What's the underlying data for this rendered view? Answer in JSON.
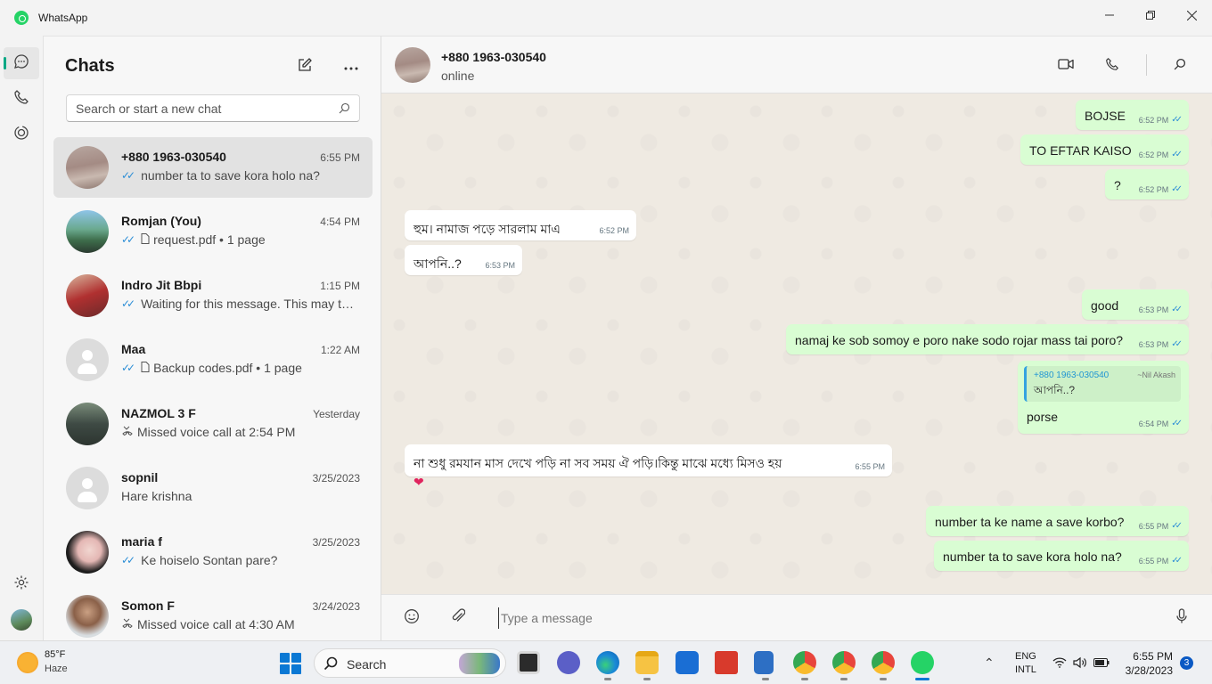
{
  "window": {
    "title": "WhatsApp"
  },
  "sidebar": {
    "title": "Chats",
    "search_placeholder": "Search or start a new chat",
    "chats": [
      {
        "name": "+880 1963-030540",
        "time": "6:55 PM",
        "preview": "number ta to save kora holo na?",
        "ticks": true,
        "icon": "",
        "selected": true
      },
      {
        "name": "Romjan (You)",
        "time": "4:54 PM",
        "preview": "request.pdf • 1 page",
        "ticks": true,
        "icon": "document-icon"
      },
      {
        "name": "Indro Jit Bbpi",
        "time": "1:15 PM",
        "preview": "Waiting for this message. This may take a while.",
        "ticks": true,
        "icon": ""
      },
      {
        "name": "Maa",
        "time": "1:22 AM",
        "preview": "Backup codes.pdf • 1 page",
        "ticks": true,
        "icon": "document-icon"
      },
      {
        "name": "NAZMOL 3 F",
        "time": "Yesterday",
        "preview": "Missed voice call at 2:54 PM",
        "ticks": false,
        "icon": "missed-call-icon"
      },
      {
        "name": "sopnil",
        "time": "3/25/2023",
        "preview": "Hare krishna",
        "ticks": false,
        "icon": ""
      },
      {
        "name": "maria f",
        "time": "3/25/2023",
        "preview": "Ke hoiselo Sontan pare?",
        "ticks": true,
        "icon": ""
      },
      {
        "name": "Somon F",
        "time": "3/24/2023",
        "preview": "Missed voice call at 4:30 AM",
        "ticks": false,
        "icon": "missed-call-icon"
      }
    ]
  },
  "conversation": {
    "contact_name": "+880 1963-030540",
    "status": "online",
    "messages": [
      {
        "dir": "out",
        "text": "BOJSE",
        "time": "6:52 PM"
      },
      {
        "dir": "out",
        "text": "TO EFTAR KAISO",
        "time": "6:52 PM"
      },
      {
        "dir": "out",
        "text": "?",
        "time": "6:52 PM"
      },
      {
        "dir": "in",
        "text": "হুম। নামাজ পড়ে সারলাম মাএ",
        "time": "6:52 PM"
      },
      {
        "dir": "in",
        "text": "আপনি..?",
        "time": "6:53 PM"
      },
      {
        "dir": "out",
        "text": "good",
        "time": "6:53 PM"
      },
      {
        "dir": "out",
        "text": "namaj ke sob somoy e poro nake sodo rojar mass tai poro?",
        "time": "6:53 PM"
      },
      {
        "dir": "out",
        "text": "porse",
        "time": "6:54 PM",
        "quote": {
          "author": "+880 1963-030540",
          "sender": "~Nil Akash",
          "text": "আপনি..?"
        }
      },
      {
        "dir": "in",
        "text": "না শুধু রমযান  মাস দেখে পড়ি না সব সময় ঐ পড়ি।কিন্তু মাঝে মধ্যে মিসও হয়",
        "time": "6:55 PM",
        "reaction": "❤"
      },
      {
        "dir": "out",
        "text": "number ta ke name a save korbo?",
        "time": "6:55 PM"
      },
      {
        "dir": "out",
        "text": "number ta to save kora holo na?",
        "time": "6:55 PM"
      }
    ]
  },
  "composer": {
    "placeholder": "Type a message"
  },
  "taskbar": {
    "weather_temp": "85°F",
    "weather_desc": "Haze",
    "search_label": "Search",
    "lang_line1": "ENG",
    "lang_line2": "INTL",
    "time": "6:55 PM",
    "date": "3/28/2023",
    "notification_count": "3"
  },
  "colors": {
    "accent": "#00a884",
    "outgoing_bubble": "#d9fdd3",
    "read_ticks": "#2c8ed6"
  }
}
